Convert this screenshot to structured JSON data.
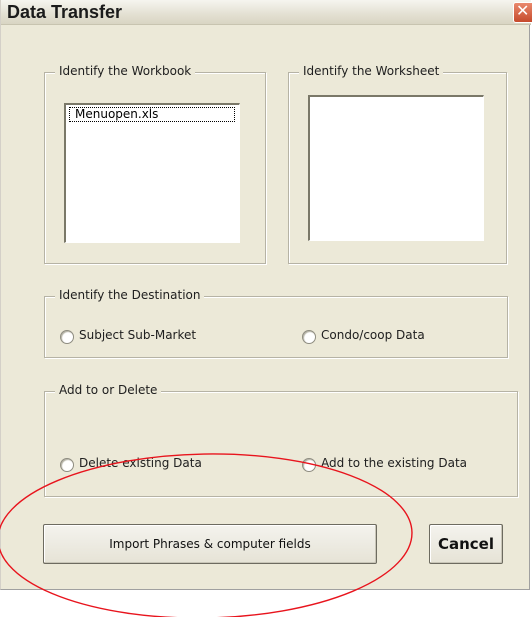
{
  "window": {
    "title": "Data Transfer",
    "close_icon": "close-icon"
  },
  "workbook_group": {
    "label": "Identify the Workbook",
    "items": [
      "Menuopen.xls"
    ]
  },
  "worksheet_group": {
    "label": "Identify the Worksheet",
    "items": []
  },
  "destination_group": {
    "label": "Identify the Destination",
    "options": [
      "Subject Sub-Market",
      "Condo/coop Data"
    ]
  },
  "add_delete_group": {
    "label": "Add to or Delete",
    "options": [
      "Delete existing Data",
      "Add to the existing Data"
    ]
  },
  "buttons": {
    "import_label": "Import Phrases & computer fields",
    "cancel_label": "Cancel"
  },
  "colors": {
    "annotation": "#e8141d",
    "dialog_bg": "#ece9d8"
  }
}
